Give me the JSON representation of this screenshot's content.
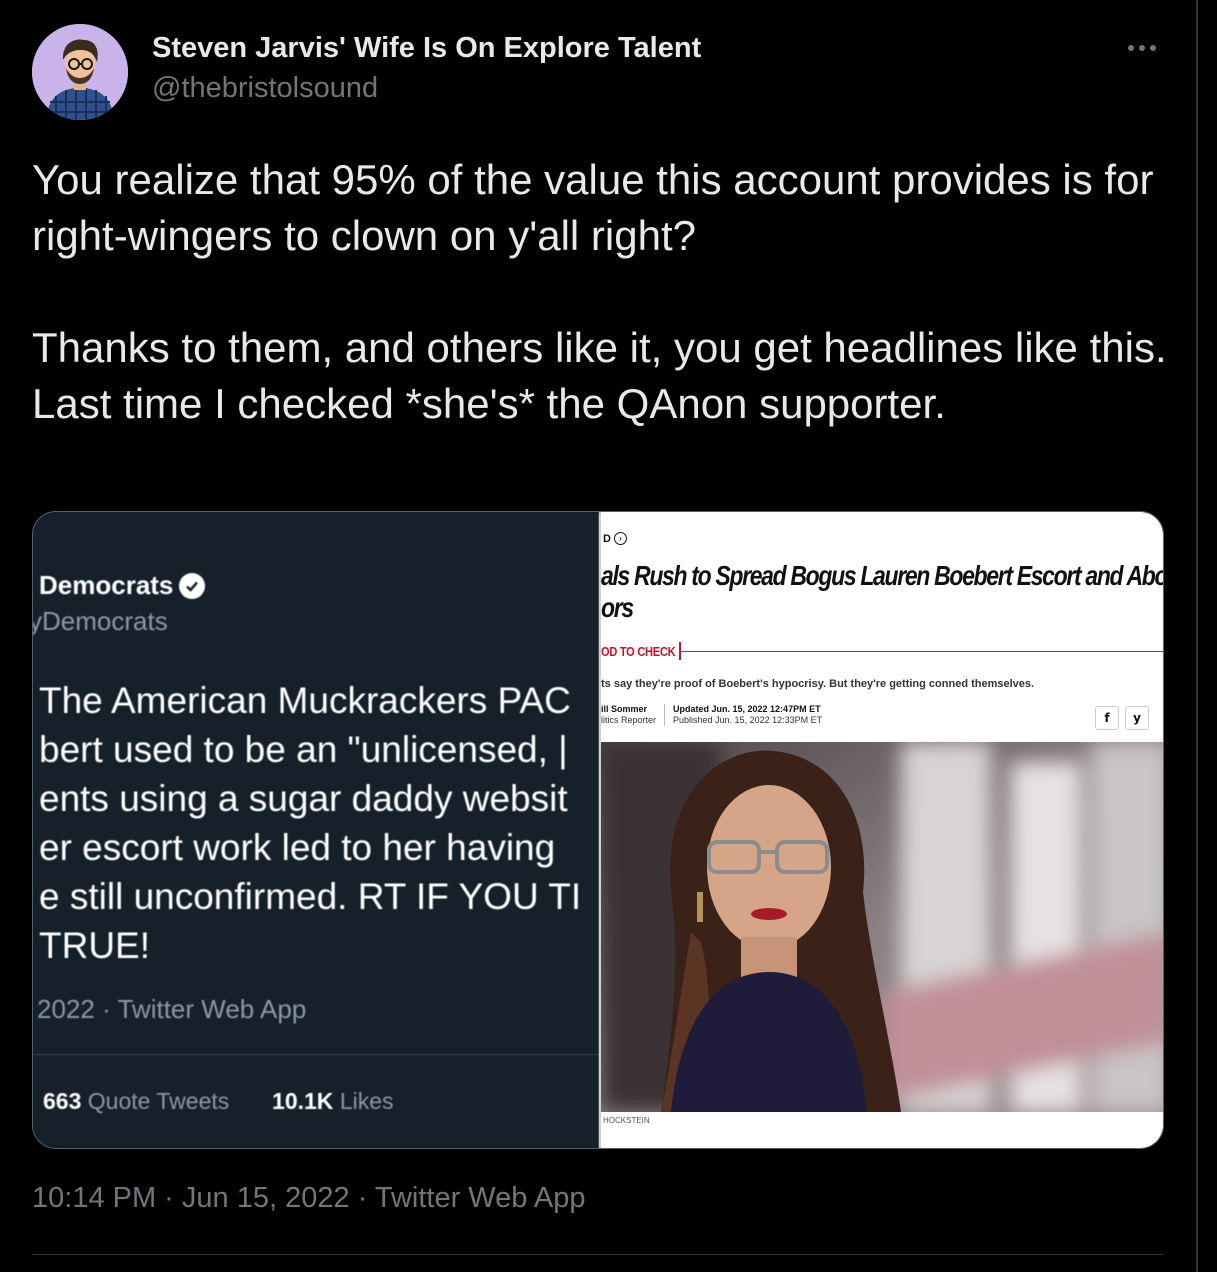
{
  "author": {
    "display_name": "Steven Jarvis' Wife Is On Explore Talent",
    "handle": "@thebristolsound"
  },
  "tweet": {
    "paragraphs": [
      "You realize that 95% of the value this account provides is for right-wingers to clown on y'all right?",
      "Thanks to them, and others like it, you get headlines like this.  Last time I checked *she's* the QAnon supporter."
    ],
    "timestamp": "10:14 PM · Jun 15, 2022 · Twitter Web App"
  },
  "media": {
    "left_screenshot": {
      "name": "Democrats",
      "handle": "yDemocrats",
      "body_lines": [
        "The American Muckrackers PAC",
        "bert used to be an \"unlicensed, |",
        "ents using a sugar daddy websit",
        "er escort work led to her having",
        "e still unconfirmed. RT IF YOU TI",
        "TRUE!"
      ],
      "meta": "2022 · Twitter Web App",
      "quote_tweets_count": "663",
      "quote_tweets_label": "Quote Tweets",
      "likes_count": "10.1K",
      "likes_label": "Likes"
    },
    "right_screenshot": {
      "kicker": "D",
      "headline_lines": [
        "als Rush to Spread Bogus Lauren Boebert Escort and Abortion",
        "ors"
      ],
      "tag": "OD TO CHECK",
      "dek": "ts say they're proof of Boebert's hypocrisy. But they're getting conned themselves.",
      "author_name": "ill Sommer",
      "author_role": "litics Reporter",
      "updated": "Updated Jun. 15, 2022 12:47PM ET",
      "published": "Published Jun. 15, 2022 12:33PM ET",
      "share_icons": [
        "f",
        "y"
      ],
      "photo_credit": "HOCKSTEIN"
    }
  },
  "colors": {
    "background": "#000000",
    "text_primary": "#e7e9ea",
    "text_secondary": "#71767b",
    "divider": "#2f3336",
    "headline_accent": "#c8102e"
  }
}
